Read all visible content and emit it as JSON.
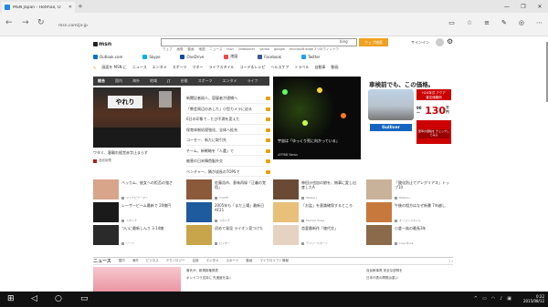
{
  "browser": {
    "tab_title": "MSN Japan - Hotmail, O",
    "url": "msn.com/ja-jp",
    "window_controls": [
      "minimize-icon",
      "restore-icon",
      "close-icon"
    ],
    "toolbar_icons": [
      "reading-view-icon",
      "favorites-icon",
      "hub-icon",
      "note-icon",
      "share-icon",
      "more-icon"
    ]
  },
  "msn": {
    "logo": "msn",
    "search_placeholder": "",
    "bing_label": "bing",
    "web_search": "ウェブ検索",
    "quick_links": [
      "ウェブ",
      "画像",
      "動画",
      "地図",
      "ニュース",
      "msn",
      "lineblaster",
      "yahoo",
      "google",
      "microsoft edge 2つのウィンドウ"
    ],
    "signin": "サインイン"
  },
  "services": [
    {
      "label": "Outlook.com",
      "color": "#0072c6"
    },
    {
      "label": "Skype",
      "color": "#00aff0"
    },
    {
      "label": "OneDrive",
      "color": "#0a4ea3"
    },
    {
      "label": "地図",
      "color": "#ee4a4a"
    },
    {
      "label": "Facebook",
      "color": "#3b5998"
    },
    {
      "label": "Twitter",
      "color": "#1da1f2"
    }
  ],
  "topnav": [
    "ニュース",
    "エンタメ",
    "スポーツ",
    "マネー",
    "ライフスタイル",
    "コーデ＆レシピ",
    "ヘルスケア",
    "トラベル",
    "自動車",
    "動画"
  ],
  "topnav_pin": "画面を MSN に",
  "darkbar_tabs": [
    "総合",
    "国内",
    "海外",
    "地域",
    "IT",
    "芸能",
    "スポーツ",
    "エンタメ",
    "ライフ"
  ],
  "hero": {
    "sign": "やれり",
    "caption": "ワタミ、客離れ経営赤字止まらず",
    "source": "産経新聞"
  },
  "headlines": [
    "新聞記者殺人、容疑者が逮捕へ",
    "「教会周辺のあした」小型カメラに迫る",
    "6日の印象で…たび不満を変えた",
    "保育体制処理強化、全体へ拡充",
    "コーセー、新たに取引先",
    "チーム、新戦略を「人選」で",
    "被害の日米韓首脳外交",
    "ベンチャー、隣が成長のTOPSで"
  ],
  "feature": {
    "caption": "宇宙は「ゆっくり死に向かっている」",
    "source": "AFPBB News"
  },
  "ad": {
    "title": "車検前でも、この価格。",
    "h24": "H24年式 アクア",
    "sub": "査定価格例",
    "price": "130",
    "price_prefix": "90～",
    "unit": "万円",
    "cta": "愛車の価格を チェックしてみる",
    "brand": "Gulliver"
  },
  "cards": [
    {
      "title": "ベッカム、彼女への拒否の強さ",
      "src": "マイナビウーマン"
    },
    {
      "title": "佐藤浩市、意味再録「正義の覚悟」",
      "src": "TVLIFE"
    },
    {
      "title": "神田沙也加の娘を、無事に愛し出産したA",
      "src": "Walker+"
    },
    {
      "title": "「酸化防止でアレグリアス」トップ10",
      "src": "Walker+"
    },
    {
      "title": "レーザービーム最新で 20億円",
      "src": "スポニチ"
    },
    {
      "title": "2005年も「まだ上場」最新日 AF21",
      "src": "スポニチ"
    },
    {
      "title": "「お盆」を意識確保するところ",
      "src": "Fashion Press"
    },
    {
      "title": "午後の相方はなぜ新書 7年越し",
      "src": "オリコンスタイル"
    },
    {
      "title": "ついに最新しんり 3.14億",
      "src": "リーフ"
    },
    {
      "title": "初めて発見 ライオン見つけた",
      "src": "ロイター"
    },
    {
      "title": "恋愛最新作「億代交」",
      "src": "デイリースポーツ"
    },
    {
      "title": "小倉一族の最長3年",
      "src": "Love Book"
    }
  ],
  "newsbar": {
    "title": "ニュース",
    "tabs": [
      "国内",
      "海外",
      "ビジネス",
      "テクノロジー",
      "芸能",
      "エンタメ",
      "スポーツ",
      "動画",
      "マイクロソフト情報"
    ]
  },
  "bottom_left": [
    "菅氏が、新規政権発表",
    "ポンドコラ支持に 先進度を高く"
  ],
  "bottom_right": [
    "自民幹事長 安全な説明を",
    "日本代表の問題は重い"
  ],
  "taskbar": {
    "time": "0:22",
    "date": "2015/08/12"
  }
}
